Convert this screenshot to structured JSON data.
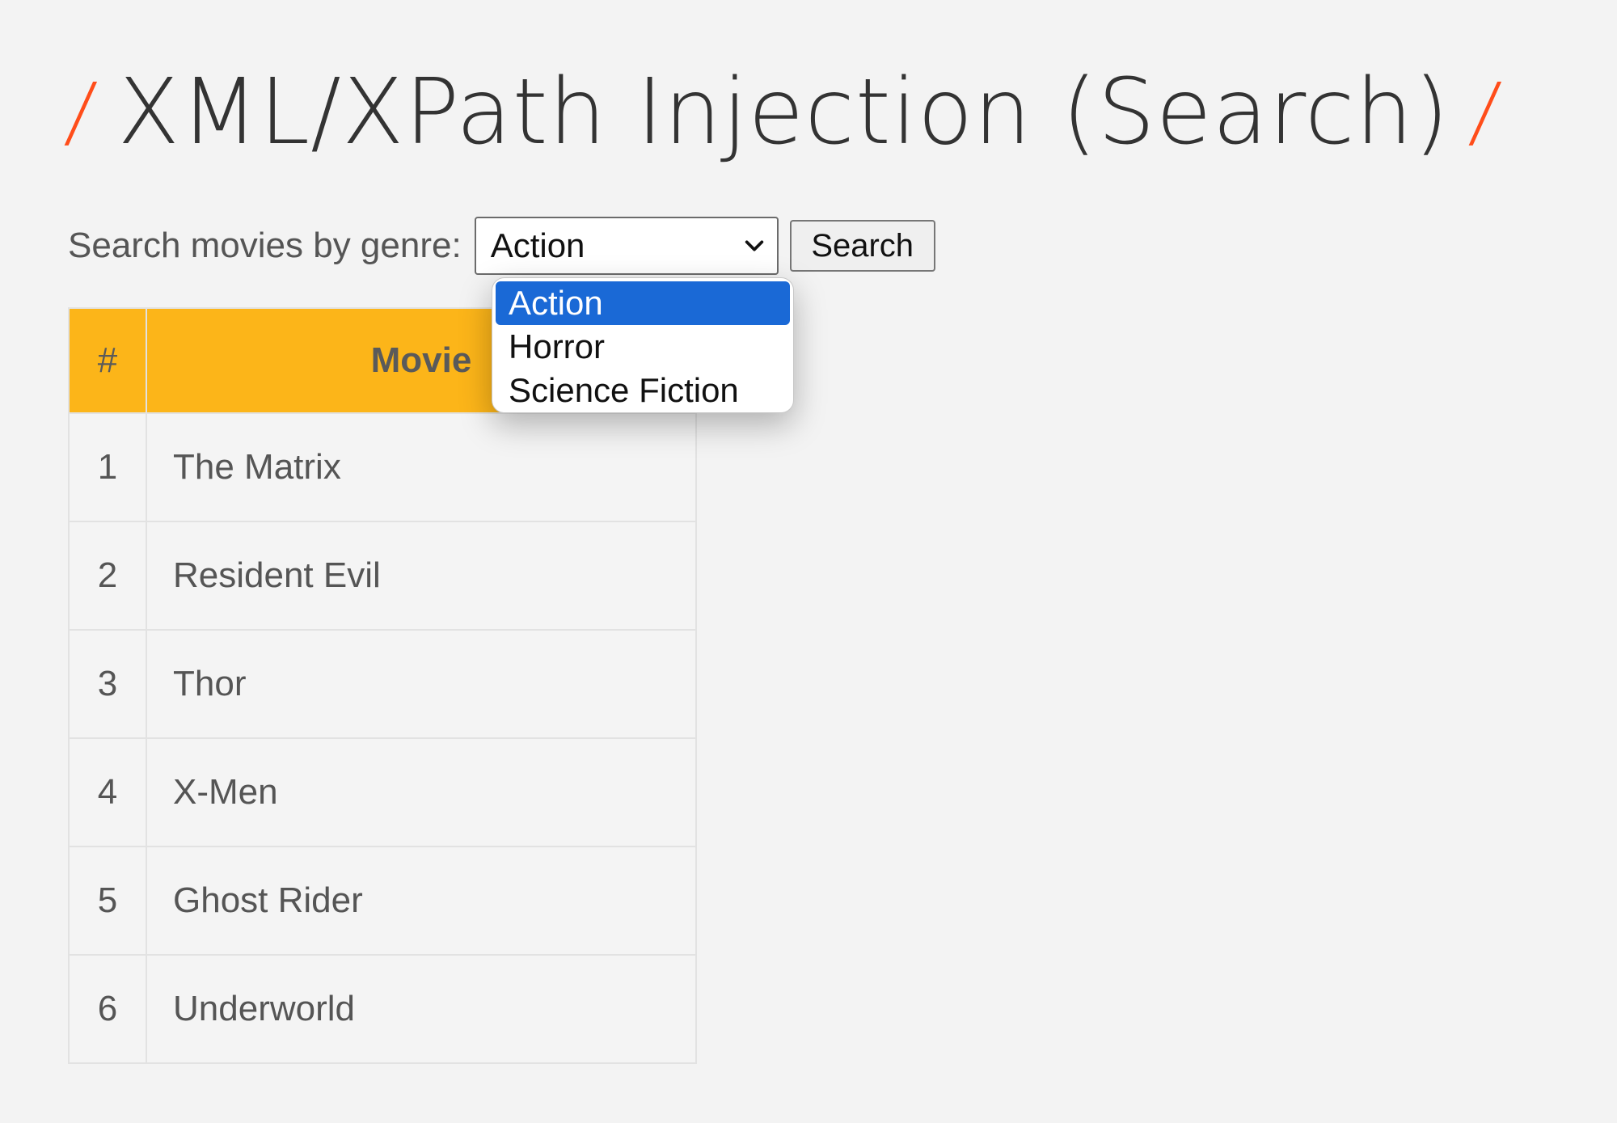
{
  "page": {
    "title": "XML/XPath Injection (Search)",
    "title_decoration": "/"
  },
  "search": {
    "label": "Search movies by genre:",
    "selected": "Action",
    "options": [
      "Action",
      "Horror",
      "Science Fiction"
    ],
    "button_label": "Search"
  },
  "table": {
    "headers": [
      "#",
      "Movie"
    ],
    "rows": [
      {
        "num": "1",
        "name": "The Matrix"
      },
      {
        "num": "2",
        "name": "Resident Evil"
      },
      {
        "num": "3",
        "name": "Thor"
      },
      {
        "num": "4",
        "name": "X-Men"
      },
      {
        "num": "5",
        "name": "Ghost Rider"
      },
      {
        "num": "6",
        "name": "Underworld"
      }
    ]
  },
  "colors": {
    "background": "#f3f3f3",
    "header_fill": "#fcb519",
    "title_accent": "#ff4d1a",
    "option_highlight": "#1a69d6"
  },
  "icons": {
    "select_arrow": "chevron-down-icon"
  }
}
